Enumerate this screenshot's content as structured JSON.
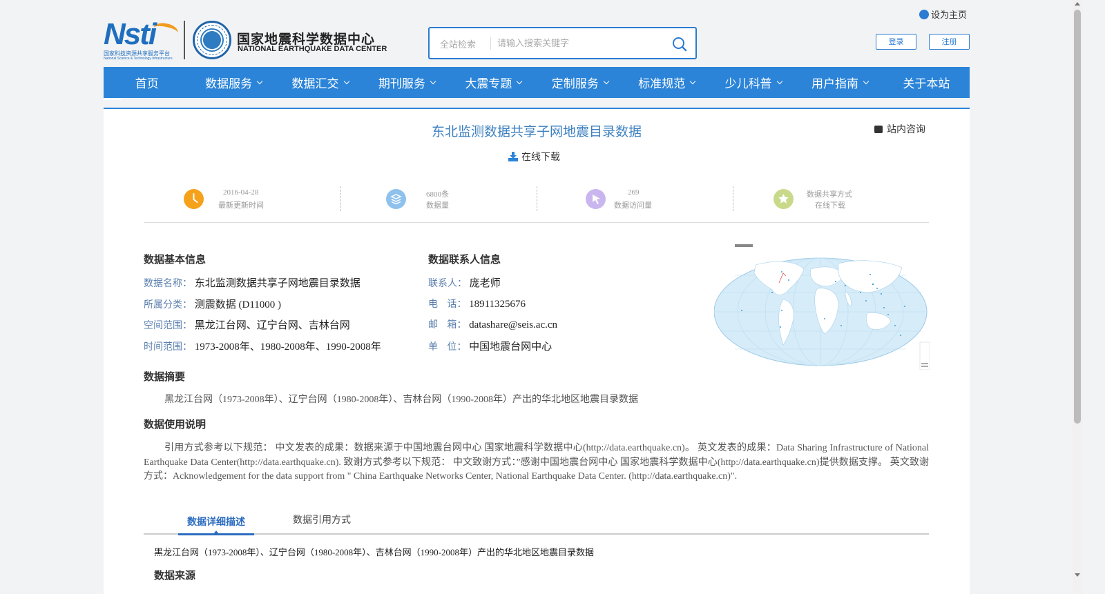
{
  "header": {
    "logo_nsti_text": "Nsti",
    "logo_nsti_cn": "国家科技资源共享服务平台",
    "logo_nsti_en": "National Science & Technology Infrastructure",
    "logo_center_cn": "国家地震科学数据中心",
    "logo_center_en": "NATIONAL EARTHQUAKE DATA CENTER",
    "search_scope": "全站检索",
    "search_placeholder": "请输入搜索关键字",
    "set_home": "设为主页",
    "login": "登录",
    "register": "注册"
  },
  "nav": {
    "items": [
      {
        "label": "首页",
        "dropdown": false
      },
      {
        "label": "数据服务",
        "dropdown": true
      },
      {
        "label": "数据汇交",
        "dropdown": true
      },
      {
        "label": "期刊服务",
        "dropdown": true
      },
      {
        "label": "大震专题",
        "dropdown": true
      },
      {
        "label": "定制服务",
        "dropdown": true
      },
      {
        "label": "标准规范",
        "dropdown": true
      },
      {
        "label": "少儿科普",
        "dropdown": true
      },
      {
        "label": "用户指南",
        "dropdown": true
      },
      {
        "label": "关于本站",
        "dropdown": false
      }
    ]
  },
  "dataset": {
    "title": "东北监测数据共享子网地震目录数据",
    "consult": "站内咨询",
    "download": "在线下载"
  },
  "stats": [
    {
      "value": "2016-04-28",
      "label": "最新更新时间",
      "color": "#f5a11c",
      "icon": "clock-icon"
    },
    {
      "value": "6800条",
      "label": "数据量",
      "color": "#8ec1ec",
      "icon": "layers-icon"
    },
    {
      "value": "269",
      "label": "数据访问量",
      "color": "#c9b6ef",
      "icon": "cursor-icon"
    },
    {
      "value": "数据共享方式",
      "label": "在线下载",
      "color": "#c8d98a",
      "icon": "star-icon"
    }
  ],
  "basic_info": {
    "heading": "数据基本信息",
    "rows": [
      {
        "key": "数据名称：",
        "value": "东北监测数据共享子网地震目录数据"
      },
      {
        "key": "所属分类：",
        "value": "测震数据 (D11000 )"
      },
      {
        "key": "空间范围：",
        "value": "黑龙江台网、辽宁台网、吉林台网"
      },
      {
        "key": "时间范围：",
        "value": "1973-2008年、1980-2008年、1990-2008年"
      }
    ]
  },
  "contact_info": {
    "heading": "数据联系人信息",
    "rows": [
      {
        "key": "联系人：",
        "value": "庞老师"
      },
      {
        "key": "电   话：",
        "value": "18911325676"
      },
      {
        "key": "邮   箱：",
        "value": "datashare@seis.ac.cn"
      },
      {
        "key": "单   位：",
        "value": "中国地震台网中心"
      }
    ]
  },
  "abstract": {
    "heading": "数据摘要",
    "text": "黑龙江台网（1973-2008年）、辽宁台网（1980-2008年）、吉林台网（1990-2008年）产出的华北地区地震目录数据"
  },
  "usage": {
    "heading": "数据使用说明",
    "text": "引用方式参考以下规范： 中文发表的成果：数据来源于中国地震台网中心 国家地震科学数据中心(http://data.earthquake.cn)。 英文发表的成果：Data Sharing Infrastructure of National Earthquake Data Center(http://data.earthquake.cn). 致谢方式参考以下规范： 中文致谢方式：”感谢中国地震台网中心 国家地震科学数据中心(http://data.earthquake.cn)提供数据支撑。 英文致谢方式：Acknowledgement for the data support from \" China Earthquake Networks Center, National Earthquake Data Center. (http://data.earthquake.cn)\"."
  },
  "tabs": {
    "items": [
      "数据详细描述",
      "数据引用方式"
    ],
    "active": 0,
    "body": "黑龙江台网（1973-2008年）、辽宁台网（1980-2008年）、吉林台网（1990-2008年）产出的华北地区地震目录数据",
    "source_heading": "数据来源"
  },
  "colors": {
    "nav_bg": "#2b84d8",
    "title": "#3b7fc0",
    "key_label": "#5a7fae",
    "map_ocean": "#cfe8f6",
    "map_land": "#ffffff"
  }
}
